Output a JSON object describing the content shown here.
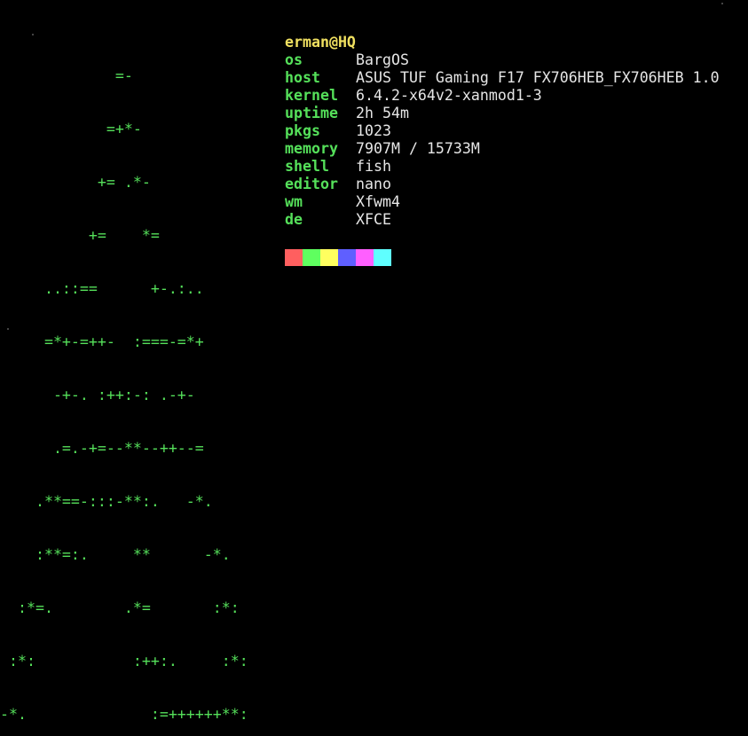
{
  "ascii_art": [
    "             =-",
    "            =+*-",
    "           += .*-",
    "          +=    *=",
    "     ..::==      +-.:..",
    "     =*+-=++-  :===-=*+",
    "      -+-. :++:-: .-+-",
    "      .=.-+=--**--++--=",
    "    .**==-:::-**:.   -*.",
    "    :**=:.     **      -*.",
    "  :*=.        .*=       :*:",
    " :*:           :++:.     :*:",
    "-*.              :=++++++**:"
  ],
  "user_host": "erman@HQ",
  "info": [
    {
      "key": "os",
      "value": "BargOS"
    },
    {
      "key": "host",
      "value": "ASUS TUF Gaming F17 FX706HEB_FX706HEB 1.0"
    },
    {
      "key": "kernel",
      "value": "6.4.2-x64v2-xanmod1-3"
    },
    {
      "key": "uptime",
      "value": "2h 54m"
    },
    {
      "key": "pkgs",
      "value": "1023"
    },
    {
      "key": "memory",
      "value": "7907M / 15733M"
    },
    {
      "key": "shell",
      "value": "fish"
    },
    {
      "key": "editor",
      "value": "nano"
    },
    {
      "key": "wm",
      "value": "Xfwm4"
    },
    {
      "key": "de",
      "value": "XFCE"
    }
  ],
  "palette": [
    "#ff5f5f",
    "#5fff5f",
    "#ffff5f",
    "#5f5fff",
    "#ff5fff",
    "#5fffff"
  ]
}
